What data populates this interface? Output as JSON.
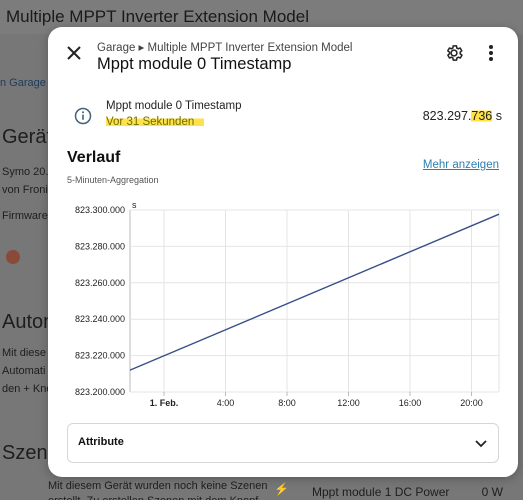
{
  "background": {
    "page_title": "Multiple MPPT Inverter Extension Model",
    "breadcrumb": "n Garage",
    "section_devices": "Gerät",
    "device_line1": "Symo 20.",
    "device_line2": "von Froni",
    "firmware": "Firmware",
    "automations_heading": "Autom",
    "automations_text": [
      "Mit diese",
      "Automati",
      "den + Kno"
    ],
    "scenes_heading": "Szene",
    "scenes_text": "Mit diesem Gerät wurden noch keine Szenen",
    "scenes_text2": "erstellt. Zu erstellen Szenen mit dem Knopf",
    "bottom_entity": "Mppt module 1 DC Power",
    "bottom_value": "0 W"
  },
  "dialog": {
    "breadcrumb": "Garage ▸ Multiple MPPT Inverter Extension Model",
    "title": "Mppt module 0 Timestamp",
    "state": {
      "name": "Mppt module 0 Timestamp",
      "relative_time": "Vor 31 Sekunden",
      "value_main": "823.297.",
      "value_tail": "736",
      "unit": "s"
    },
    "history": {
      "title": "Verlauf",
      "more_link": "Mehr anzeigen",
      "aggregation": "5-Minuten-Aggregation"
    },
    "attributes_label": "Attribute"
  },
  "colors": {
    "accent": "#2b7fb0",
    "line": "#3a4f8a",
    "highlight": "#ffe24a"
  },
  "chart_data": {
    "type": "line",
    "ylabel": "s",
    "ylim": [
      823200000,
      823300000
    ],
    "yticks": [
      823200000,
      823220000,
      823240000,
      823260000,
      823280000,
      823300000
    ],
    "ytick_labels": [
      "823.200.000",
      "823.220.000",
      "823.240.000",
      "823.260.000",
      "823.280.000",
      "823.300.000"
    ],
    "xticks": [
      "1. Feb.",
      "4:00",
      "8:00",
      "12:00",
      "16:00",
      "20:00"
    ],
    "series": [
      {
        "x": [
          "22:00",
          "23:00"
        ],
        "values": [
          823212000,
          823297700
        ]
      }
    ]
  }
}
